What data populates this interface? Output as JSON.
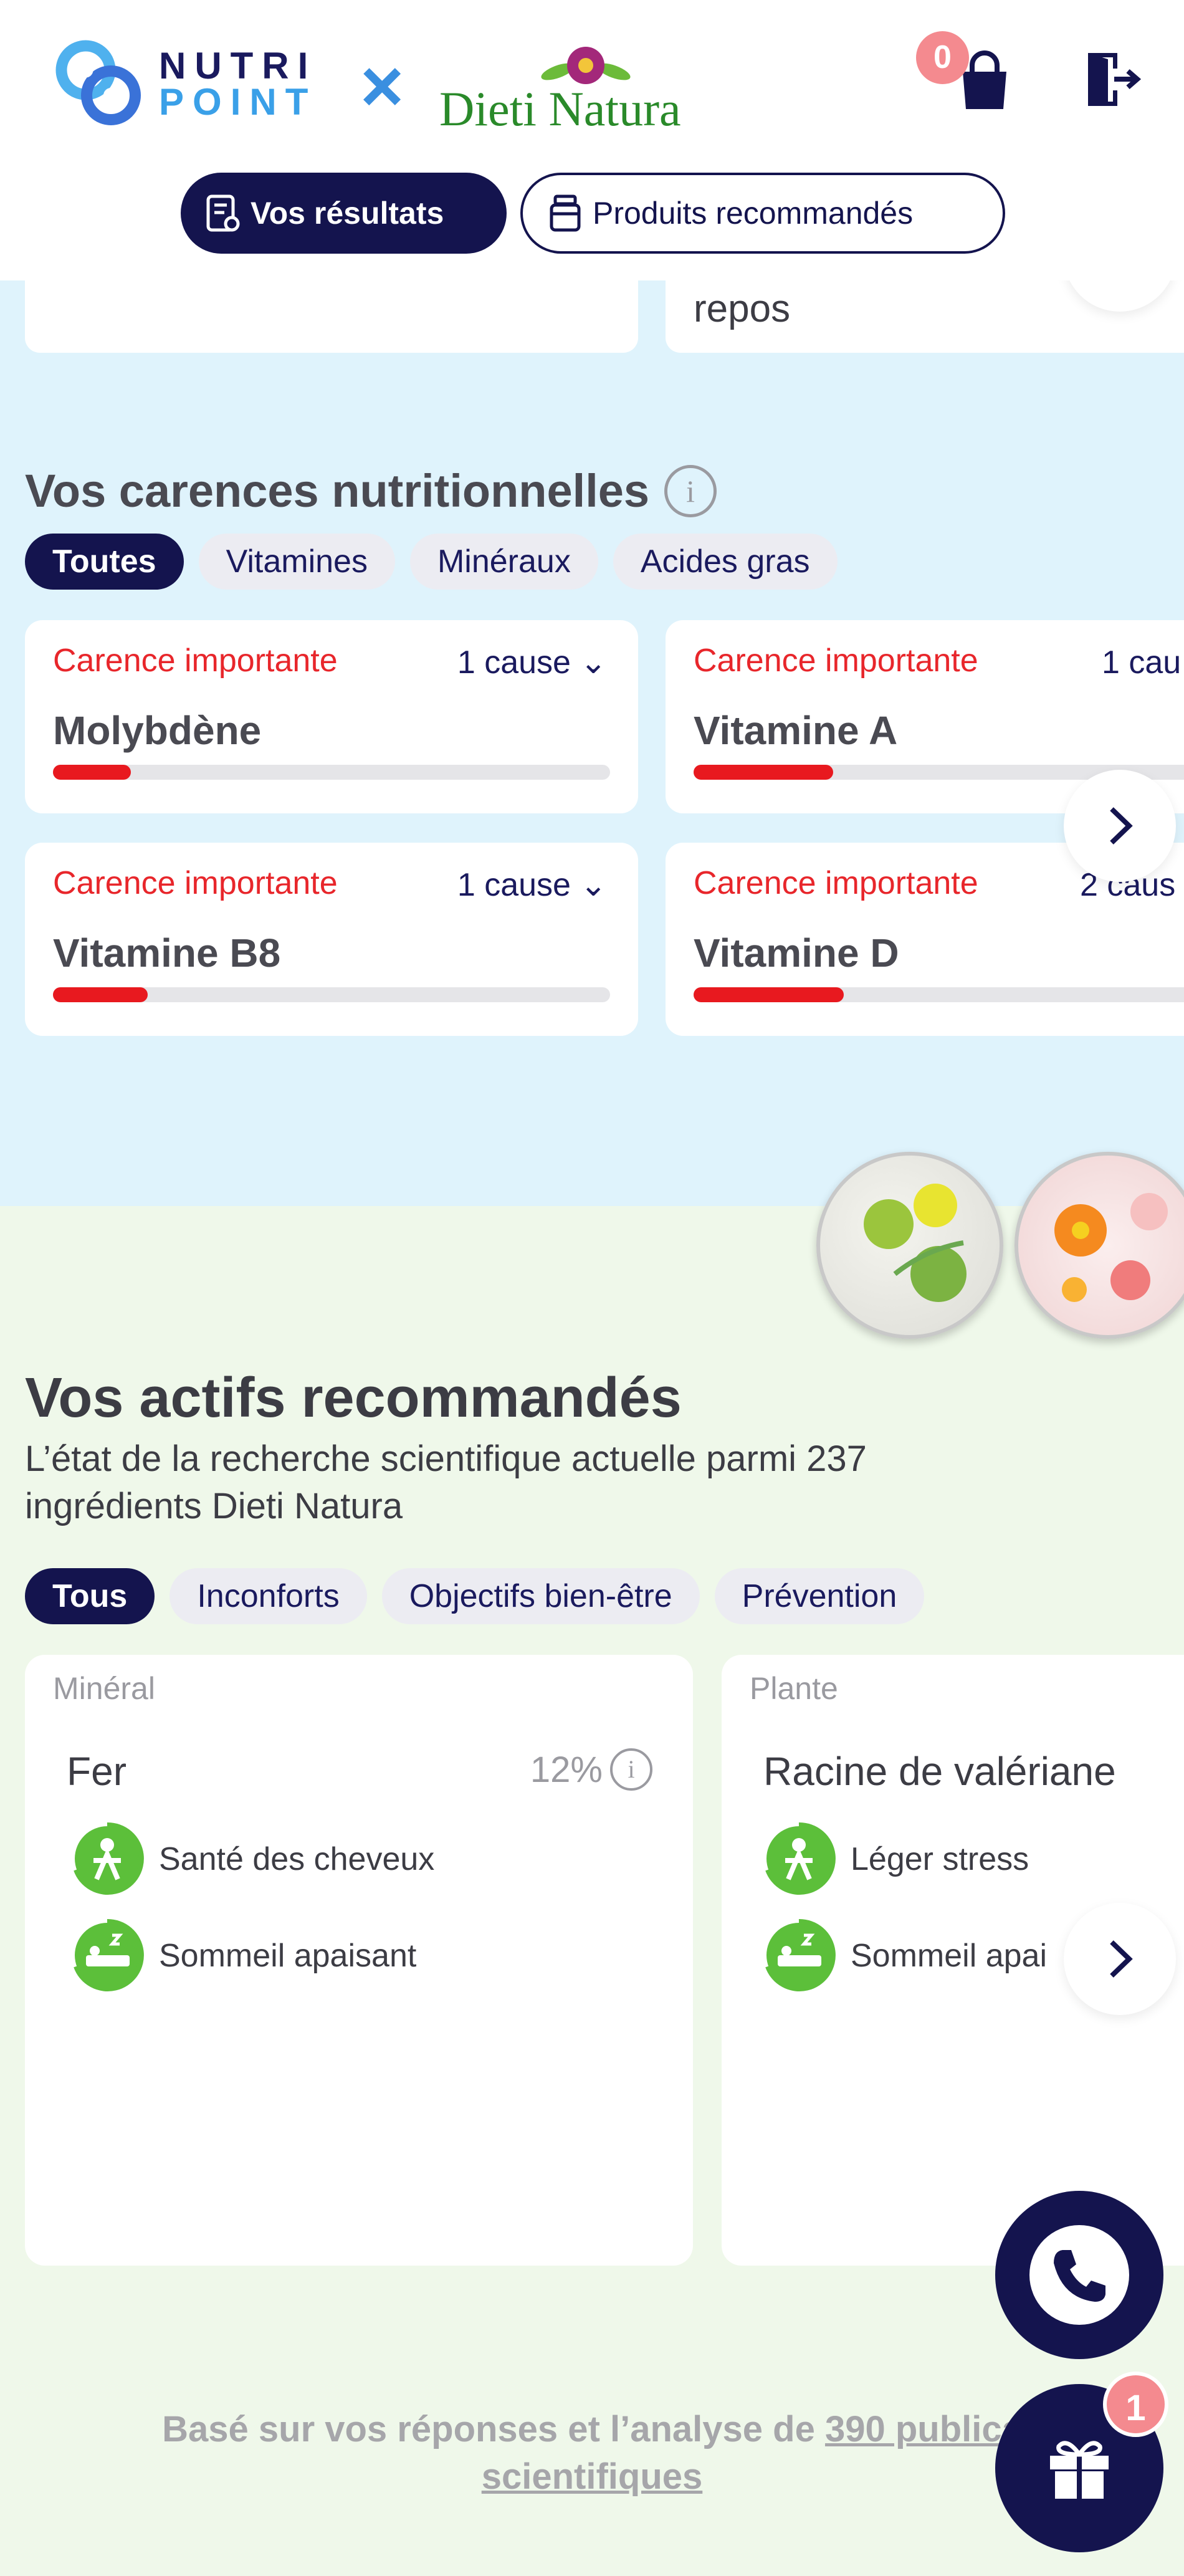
{
  "header": {
    "brand_line1": "NUTRI",
    "brand_line2": "POINT",
    "partner": "Dieti Natura",
    "cart_count": "0",
    "tabs": [
      {
        "label": "Vos résultats",
        "active": true
      },
      {
        "label": "Produits recommandés",
        "active": false
      }
    ]
  },
  "top_card": {
    "text": "repos"
  },
  "deficiencies": {
    "title": "Vos carences nutritionnelles",
    "filters": [
      "Toutes",
      "Vitamines",
      "Minéraux",
      "Acides gras"
    ],
    "items": [
      {
        "severity": "Carence importante",
        "cause": "1 cause",
        "name": "Molybdène",
        "level": 0.14
      },
      {
        "severity": "Carence importante",
        "cause": "1 cau",
        "name": "Vitamine A",
        "level": 0.25
      },
      {
        "severity": "Carence importante",
        "cause": "1 cause",
        "name": "Vitamine B8",
        "level": 0.17
      },
      {
        "severity": "Carence importante",
        "cause": "2 caus",
        "name": "Vitamine D",
        "level": 0.27
      }
    ]
  },
  "actives": {
    "title": "Vos actifs recommandés",
    "subtitle": "L’état de la recherche scientifique actuelle parmi 237 ingrédients Dieti Natura",
    "filters": [
      "Tous",
      "Inconforts",
      "Objectifs bien-être",
      "Prévention"
    ],
    "cards": [
      {
        "kind": "Minéral",
        "name": "Fer",
        "percent": "12%",
        "benefits": [
          "Santé des cheveux",
          "Sommeil apaisant"
        ]
      },
      {
        "kind": "Plante",
        "name": "Racine de valériane",
        "percent": "",
        "benefits": [
          "Léger stress",
          "Sommeil apai"
        ]
      }
    ]
  },
  "footer": {
    "text_prefix": "Basé sur vos réponses et l’analyse de ",
    "link_part1": "390 publica",
    "link_part2": "scientifiques"
  },
  "gift_count": "1",
  "colors": {
    "navy": "#14144e",
    "red": "#e8191f",
    "blue_bg": "#dff3fc",
    "green_bg": "#eff8ea",
    "badge": "#f48a8f"
  }
}
